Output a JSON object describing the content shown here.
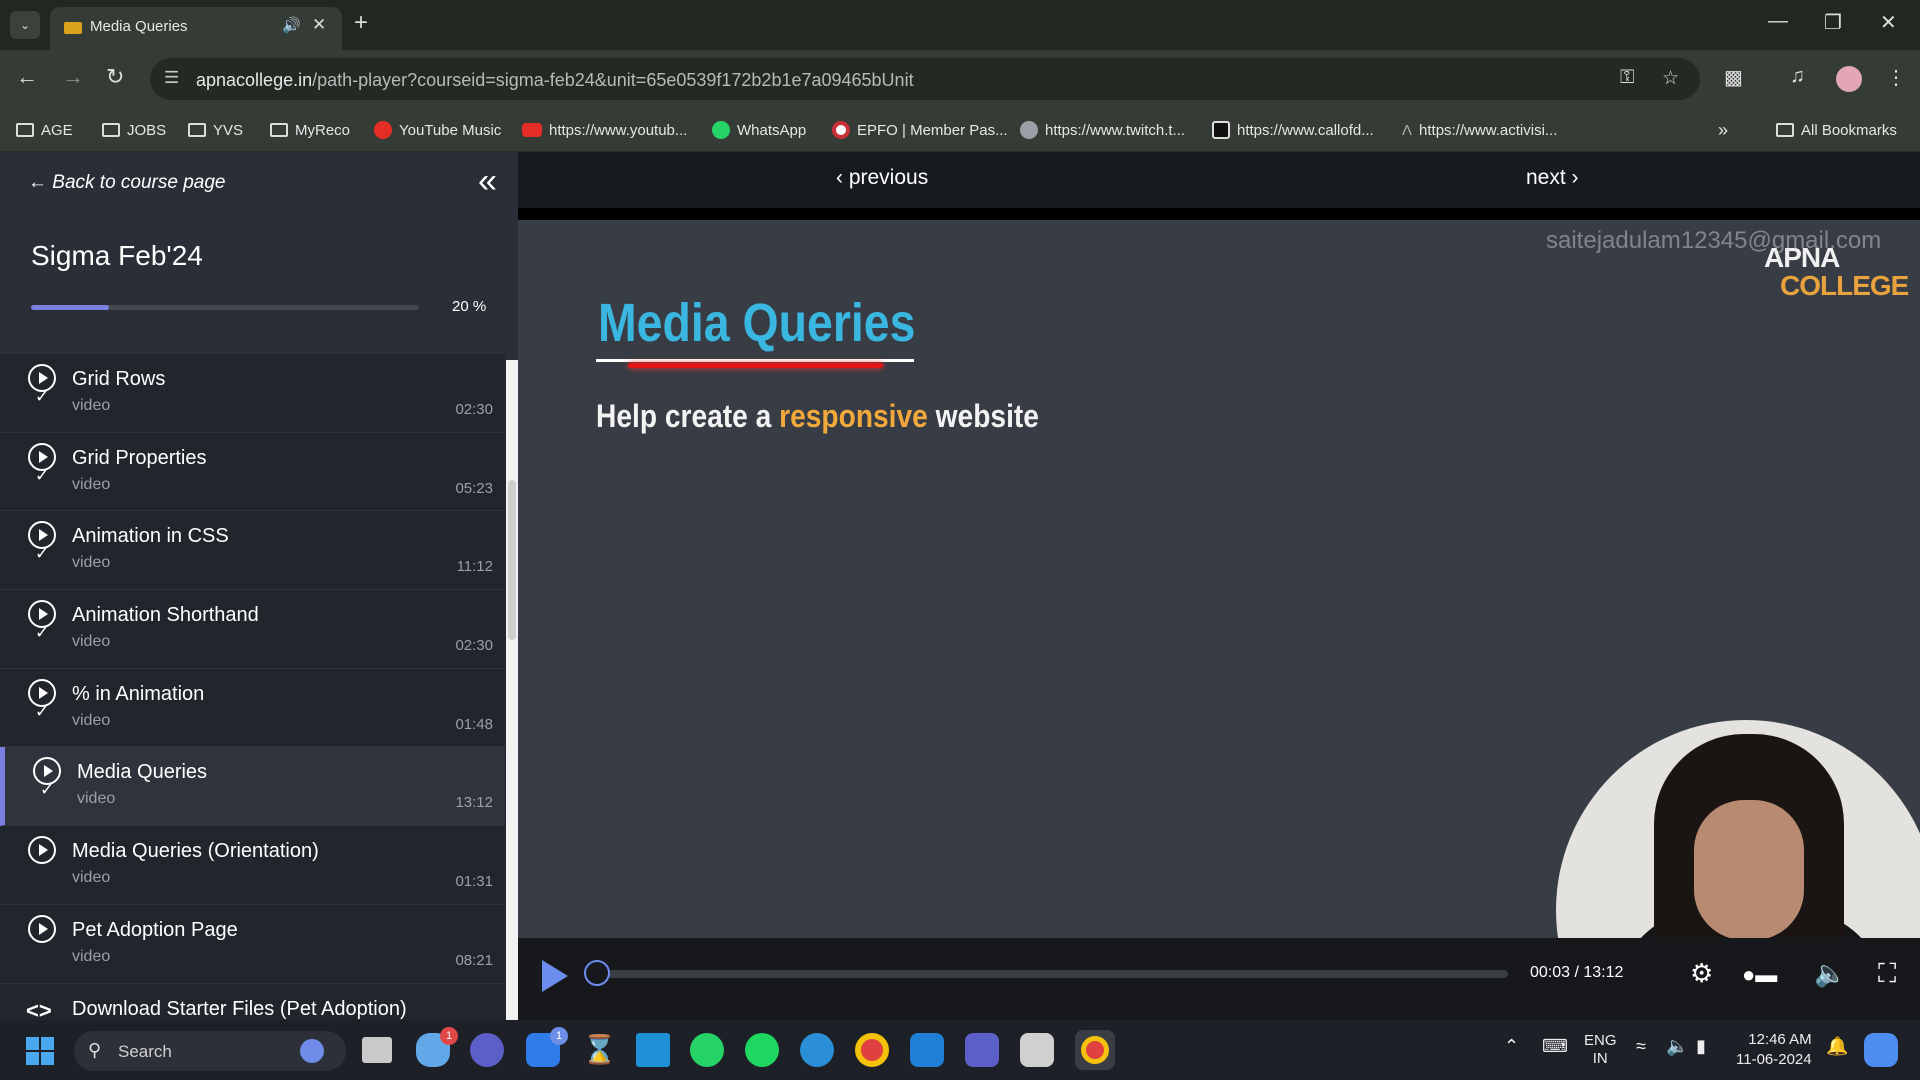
{
  "browser": {
    "tab_title": "Media Queries",
    "url_host": "apnacollege.in",
    "url_path": "/path-player?courseid=sigma-feb24&unit=65e0539f172b2b1e7a09465bUnit",
    "bookmarks": [
      {
        "label": "AGE",
        "icon": "folder-icon"
      },
      {
        "label": "JOBS",
        "icon": "folder-icon"
      },
      {
        "label": "YVS",
        "icon": "folder-icon"
      },
      {
        "label": "MyReco",
        "icon": "folder-icon"
      },
      {
        "label": "YouTube Music",
        "icon": "youtube-music-icon"
      },
      {
        "label": "https://www.youtub...",
        "icon": "youtube-icon"
      },
      {
        "label": "WhatsApp",
        "icon": "whatsapp-icon"
      },
      {
        "label": "EPFO | Member Pas...",
        "icon": "epfo-icon"
      },
      {
        "label": "https://www.twitch.t...",
        "icon": "globe-icon"
      },
      {
        "label": "https://www.callofd...",
        "icon": "callofduty-icon"
      },
      {
        "label": "https://www.activisi...",
        "icon": "activision-icon"
      }
    ],
    "all_bookmarks": "All Bookmarks"
  },
  "sidebar": {
    "back_label": "Back to course page",
    "course_title": "Sigma Feb'24",
    "progress_percent": 20,
    "progress_label": "20 %",
    "items": [
      {
        "title": "Grid Rows",
        "type": "video",
        "duration": "02:30",
        "kind": "video",
        "done": true
      },
      {
        "title": "Grid Properties",
        "type": "video",
        "duration": "05:23",
        "kind": "video",
        "done": true
      },
      {
        "title": "Animation in CSS",
        "type": "video",
        "duration": "11:12",
        "kind": "video",
        "done": true
      },
      {
        "title": "Animation Shorthand",
        "type": "video",
        "duration": "02:30",
        "kind": "video",
        "done": true
      },
      {
        "title": "% in Animation",
        "type": "video",
        "duration": "01:48",
        "kind": "video",
        "done": true
      },
      {
        "title": "Media Queries",
        "type": "video",
        "duration": "13:12",
        "kind": "video",
        "done": true,
        "active": true
      },
      {
        "title": "Media Queries (Orientation)",
        "type": "video",
        "duration": "01:31",
        "kind": "video",
        "done": false
      },
      {
        "title": "Pet Adoption Page",
        "type": "video",
        "duration": "08:21",
        "kind": "video",
        "done": false
      },
      {
        "title": "Download Starter Files (Pet Adoption)",
        "type": "",
        "duration": "",
        "kind": "code",
        "done": false
      }
    ]
  },
  "player": {
    "previous_label": "previous",
    "next_label": "next",
    "watermark": "saitejadulam12345@gmail.com",
    "logo_line1": "APNA",
    "logo_line2": "COLLEGE",
    "slide_title": "Media Queries",
    "slide_sub_before": "Help create a ",
    "slide_sub_highlight": "responsive",
    "slide_sub_after": " website",
    "time": "00:03 / 13:12",
    "seek_fraction": 0.004
  },
  "taskbar": {
    "search_label": "Search",
    "lang_line1": "ENG",
    "lang_line2": "IN",
    "time": "12:46 AM",
    "date": "11-06-2024",
    "badge_onedrive": "1",
    "badge_todo": "1"
  },
  "colors": {
    "accent": "#7a7fe0",
    "player_accent": "#6d8cf0",
    "slide_title": "#3ab7e0",
    "slide_highlight": "#f2a93b"
  }
}
